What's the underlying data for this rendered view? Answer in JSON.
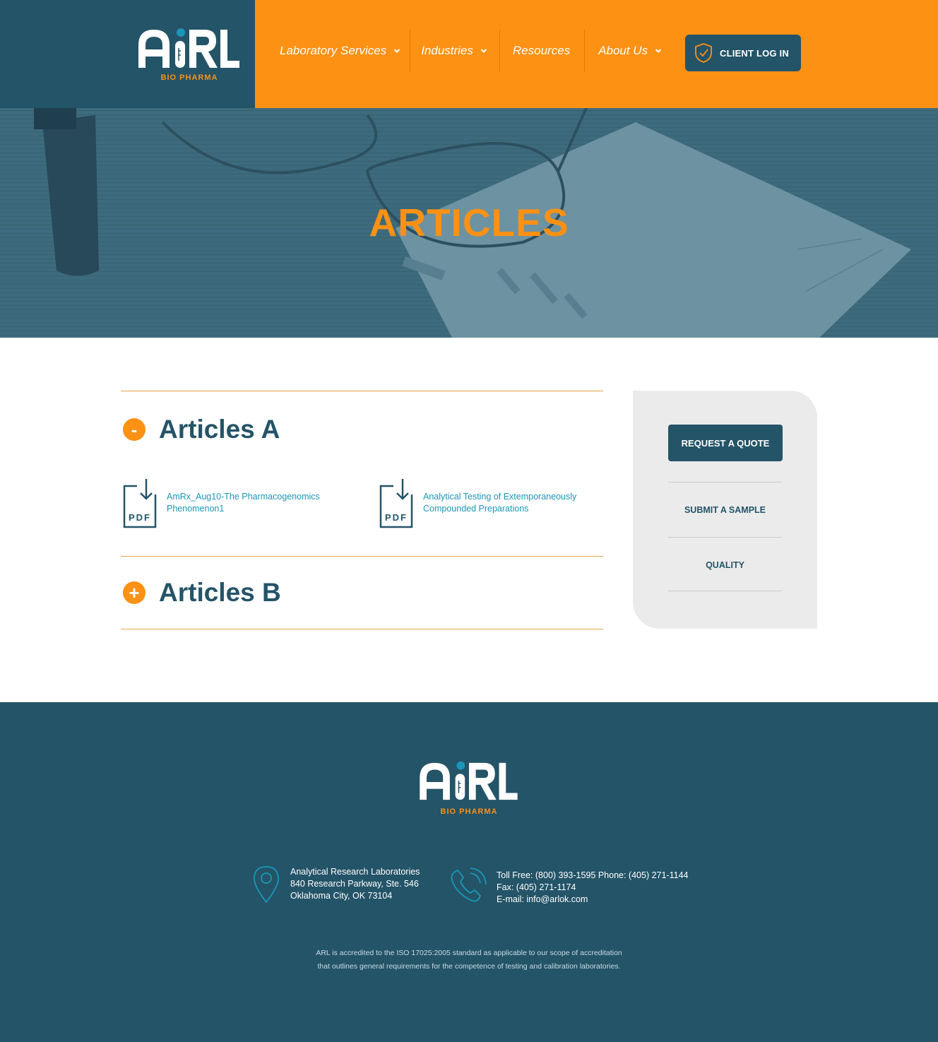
{
  "brand": {
    "name": "ARL",
    "tagline": "BIO PHARMA",
    "colors": {
      "primary": "#245468",
      "accent": "#fd9114",
      "link": "#1a97b8"
    }
  },
  "nav": {
    "items": [
      {
        "label": "Laboratory Services",
        "has_dropdown": true
      },
      {
        "label": "Industries",
        "has_dropdown": true
      },
      {
        "label": "Resources",
        "has_dropdown": false
      },
      {
        "label": "About Us",
        "has_dropdown": true
      }
    ],
    "login": {
      "label": "CLIENT LOG IN",
      "icon": "shield-check-icon"
    }
  },
  "hero": {
    "title": "ARTICLES"
  },
  "accordion": {
    "sections": [
      {
        "title": "Articles A",
        "toggle": "-",
        "expanded": true,
        "items": [
          {
            "title": "AmRx_Aug10-The Pharmacogenomics Phenomenon1",
            "icon_label": "PDF"
          },
          {
            "title": "Analytical Testing of Extemporaneously Compounded Preparations",
            "icon_label": "PDF"
          }
        ]
      },
      {
        "title": "Articles B",
        "toggle": "+",
        "expanded": false
      }
    ]
  },
  "sidebar": {
    "quote_button": "REQUEST A QUOTE",
    "links": [
      "SUBMIT A SAMPLE",
      "QUALITY"
    ]
  },
  "footer": {
    "address": [
      "Analytical Research Laboratories",
      "840 Research Parkway, Ste. 546",
      "Oklahoma City, OK 73104"
    ],
    "contact": [
      "Toll Free: (800) 393-1595 Phone: (405) 271-1144",
      "Fax: (405) 271-1174",
      "E-mail: info@arlok.com"
    ],
    "note": [
      "ARL is accredited to the ISO 17025:2005 standard as applicable to our scope of accreditation",
      "that outlines general requirements for the competence of testing and calibration laboratories."
    ]
  }
}
